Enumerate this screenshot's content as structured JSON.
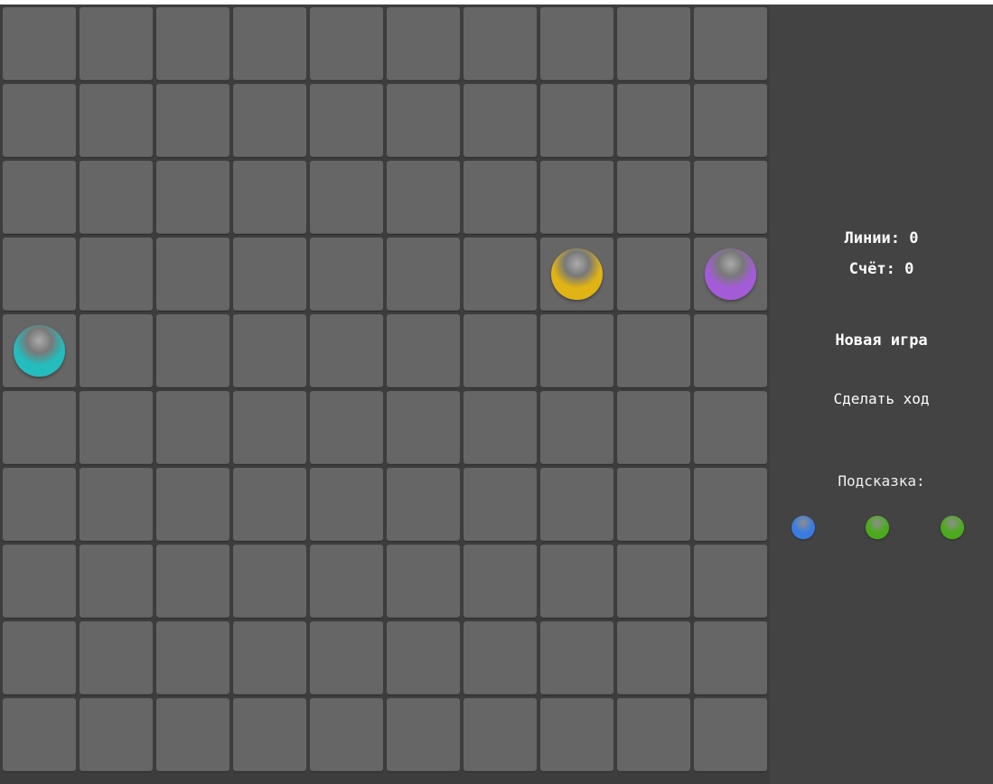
{
  "board": {
    "rows": 10,
    "cols": 10,
    "cell_color": "#666666",
    "balls": [
      {
        "row": 3,
        "col": 7,
        "color": "yellow",
        "hex": "#e0b414"
      },
      {
        "row": 3,
        "col": 9,
        "color": "purple",
        "hex": "#a45bd8"
      },
      {
        "row": 4,
        "col": 0,
        "color": "cyan",
        "hex": "#25bcbd"
      }
    ]
  },
  "stats": {
    "lines_label": "Линии:",
    "lines_value": "0",
    "score_label": "Счёт:",
    "score_value": "0"
  },
  "buttons": {
    "new_game": "Новая игра",
    "make_move": "Сделать ход"
  },
  "hint": {
    "title": "Подсказка:",
    "balls": [
      {
        "color": "blue",
        "hex": "#3a7be0"
      },
      {
        "color": "green",
        "hex": "#4caa1e"
      },
      {
        "color": "green",
        "hex": "#4caa1e"
      }
    ]
  },
  "colors": {
    "panel_background": "#434343",
    "board_background": "#3d3d3d"
  }
}
